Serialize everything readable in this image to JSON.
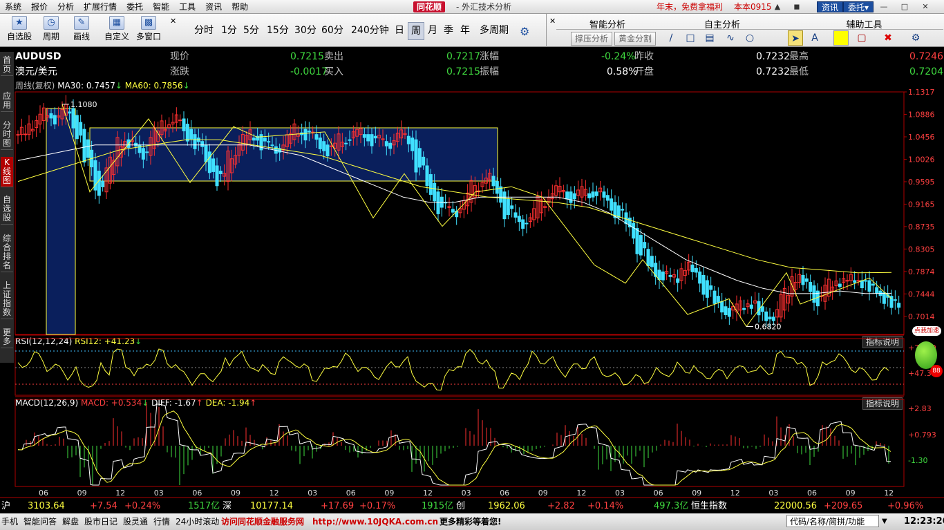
{
  "menubar": {
    "items": [
      "系统",
      "报价",
      "分析",
      "扩展行情",
      "委托",
      "智能",
      "工具",
      "资讯",
      "帮助"
    ],
    "brand": "同花顺",
    "title": "- 外汇技术分析",
    "promo": "年末，免费拿福利",
    "version": "本本0915",
    "btn_news": "资讯",
    "btn_trade": "委托▾"
  },
  "toolbar": {
    "buttons": [
      "自选股",
      "周期",
      "画线",
      "自定义",
      "多窗口"
    ],
    "periods": [
      "分时",
      "1分",
      "5分",
      "15分",
      "30分",
      "60分",
      "240分钟",
      "日",
      "周",
      "月",
      "季",
      "年",
      "多周期"
    ],
    "active_period": "周",
    "panels": [
      "智能分析",
      "自主分析",
      "辅助工具"
    ],
    "sub_buttons": [
      "撑压分析",
      "黄金分割"
    ]
  },
  "sidetabs": [
    "首页",
    "应用",
    "分时图",
    "K线图",
    "自选股",
    "综合排名",
    "上证指数",
    "更多"
  ],
  "quote": {
    "symbol": "AUDUSD",
    "name": "澳元/美元",
    "l_now": "现价",
    "now": "0.7215",
    "l_sell": "卖出",
    "sell": "0.7217",
    "l_rise_pct": "涨幅",
    "rise_pct": "-0.24%",
    "l_prev": "昨收",
    "prev": "0.7232",
    "l_high": "最高",
    "high": "0.7246",
    "l_change": "涨跌",
    "change": "-0.0017",
    "l_buy": "买入",
    "buy": "0.7215",
    "l_amp": "振幅",
    "amp": "0.58%",
    "l_open": "开盘",
    "open": "0.7232",
    "l_low": "最低",
    "low": "0.7204"
  },
  "main_indicator": {
    "label": "周线(复权)",
    "ma30": "MA30: 0.7457",
    "ma60": "MA60: 0.7856"
  },
  "rsi_indicator": {
    "label": "RSI(12,12,24)",
    "value": "RSI12: +41.23",
    "btn": "指标说明"
  },
  "macd_indicator": {
    "label": "MACD(12,26,9)",
    "macd": "MACD: +0.534",
    "diff": "DIFF: -1.67",
    "dea": "DEA: -1.94",
    "btn": "指标说明"
  },
  "chart_data": {
    "type": "candlestick",
    "price_axis_ticks": [
      "1.1317",
      "1.0886",
      "1.0456",
      "1.0026",
      "0.9595",
      "0.9165",
      "0.8735",
      "0.8305",
      "0.7874",
      "0.7444",
      "0.7014"
    ],
    "ylim": [
      0.672,
      1.1317
    ],
    "annotations": [
      "1.1080",
      "0.6820"
    ],
    "x_ticks": [
      "06",
      "09",
      "12",
      "03",
      "06",
      "09",
      "12",
      "03",
      "06",
      "09",
      "12",
      "03",
      "06",
      "09",
      "12",
      "03",
      "06",
      "09",
      "12",
      "03",
      "06",
      "09",
      "12"
    ],
    "closes": [
      1.05,
      1.07,
      1.09,
      1.08,
      1.1,
      1.06,
      1.0,
      0.94,
      0.99,
      1.04,
      1.03,
      1.01,
      1.05,
      1.07,
      1.08,
      1.05,
      1.03,
      0.99,
      0.96,
      1.01,
      1.04,
      1.05,
      1.03,
      1.02,
      1.04,
      1.06,
      1.05,
      1.03,
      1.02,
      1.04,
      1.05,
      1.05,
      1.04,
      1.03,
      1.05,
      1.04,
      0.99,
      0.94,
      0.91,
      0.9,
      0.92,
      0.95,
      0.97,
      0.94,
      0.9,
      0.88,
      0.89,
      0.92,
      0.94,
      0.94,
      0.93,
      0.94,
      0.94,
      0.92,
      0.9,
      0.87,
      0.83,
      0.79,
      0.78,
      0.77,
      0.8,
      0.78,
      0.75,
      0.72,
      0.71,
      0.72,
      0.73,
      0.7,
      0.7,
      0.74,
      0.78,
      0.76,
      0.73,
      0.76,
      0.77,
      0.77,
      0.77,
      0.75,
      0.74,
      0.72
    ],
    "ma30": [
      1.0,
      1.01,
      1.02,
      1.03,
      1.03,
      1.03,
      1.03,
      1.03,
      1.03,
      1.03,
      1.02,
      1.01,
      0.99,
      0.97,
      0.95,
      0.93,
      0.92,
      0.92,
      0.93,
      0.93,
      0.93,
      0.93,
      0.92,
      0.9,
      0.87,
      0.84,
      0.81,
      0.79,
      0.77,
      0.755,
      0.745,
      0.745,
      0.75,
      0.745,
      0.7457
    ],
    "ma60": [
      0.96,
      0.98,
      1.0,
      1.02,
      1.03,
      1.04,
      1.04,
      1.03,
      1.02,
      1.01,
      0.99,
      0.97,
      0.95,
      0.94,
      0.93,
      0.925,
      0.92,
      0.91,
      0.89,
      0.87,
      0.85,
      0.83,
      0.81,
      0.795,
      0.79,
      0.785,
      0.7856
    ]
  }
}
